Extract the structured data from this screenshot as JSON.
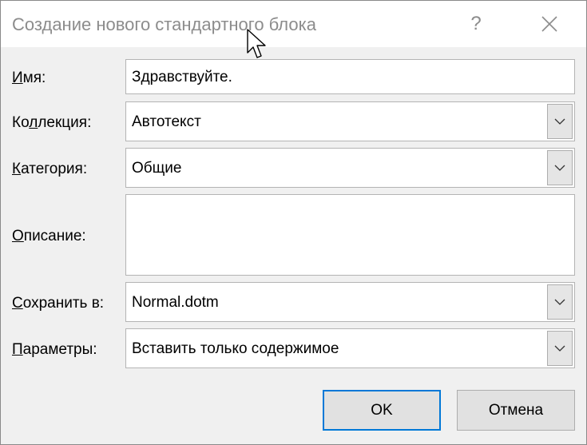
{
  "dialog": {
    "title": "Создание нового стандартного блока",
    "help_glyph": "?",
    "close_icon": "close-icon"
  },
  "fields": {
    "name": {
      "label_key": "И",
      "label_rest": "мя:",
      "value": "Здравствуйте."
    },
    "gallery": {
      "label_pre": "Ко",
      "label_key": "л",
      "label_rest": "лекция:",
      "value": "Автотекст"
    },
    "category": {
      "label_key": "К",
      "label_rest": "атегория:",
      "value": "Общие"
    },
    "description": {
      "label_key": "О",
      "label_rest": "писание:",
      "value": ""
    },
    "save_in": {
      "label_key": "С",
      "label_rest": "охранить в:",
      "value": "Normal.dotm"
    },
    "options": {
      "label_key": "П",
      "label_rest": "араметры:",
      "value": "Вставить только содержимое"
    }
  },
  "buttons": {
    "ok": "OK",
    "cancel": "Отмена"
  },
  "colors": {
    "accent": "#0078d7",
    "dialog_bg": "#f0f0f0",
    "title_text": "#8c8c8c"
  }
}
